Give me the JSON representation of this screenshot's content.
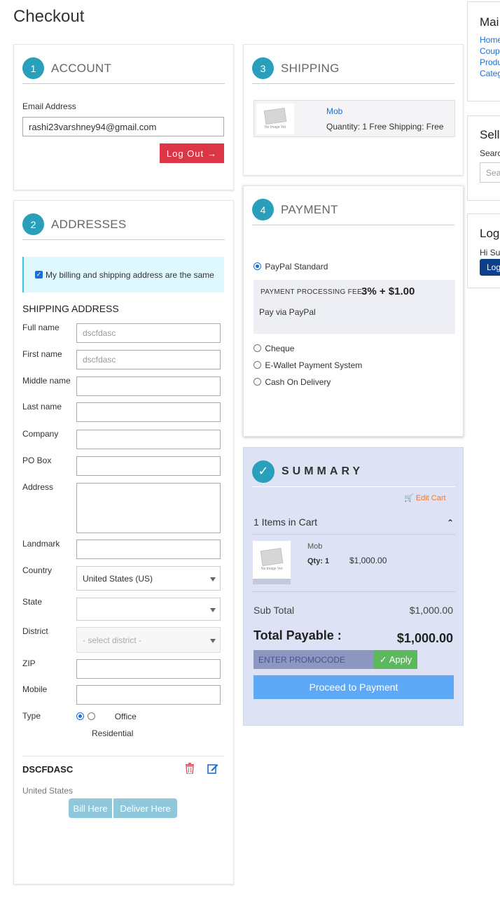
{
  "page": {
    "title": "Checkout"
  },
  "account": {
    "step": "1",
    "title": "ACCOUNT",
    "email_label": "Email Address",
    "email_value": "rashi23varshney94@gmail.com",
    "logout_label": "Log Out"
  },
  "addresses": {
    "step": "2",
    "title": "ADDRESSES",
    "same_address_label": "My billing and shipping address are the same",
    "shipping_heading": "SHIPPING ADDRESS",
    "fields": {
      "full_name": {
        "label": "Full name",
        "value": "dscfdasc"
      },
      "first_name": {
        "label": "First name",
        "value": "dscfdasc"
      },
      "middle_name": {
        "label": "Middle name",
        "value": ""
      },
      "last_name": {
        "label": "Last name",
        "value": ""
      },
      "company": {
        "label": "Company",
        "value": ""
      },
      "po_box": {
        "label": "PO Box",
        "value": ""
      },
      "address": {
        "label": "Address",
        "value": ""
      },
      "landmark": {
        "label": "Landmark",
        "value": ""
      },
      "country": {
        "label": "Country",
        "value": "United States (US)"
      },
      "state": {
        "label": "State",
        "value": ""
      },
      "district": {
        "label": "District",
        "value": "- select district -"
      },
      "zip": {
        "label": "ZIP",
        "value": ""
      },
      "mobile": {
        "label": "Mobile",
        "value": ""
      },
      "type": {
        "label": "Type",
        "option_office": "Office",
        "option_residential": "Residential"
      }
    },
    "saved": {
      "name": "DSCFDASC",
      "country": "United States",
      "bill_label": "Bill Here",
      "deliver_label": "Deliver Here"
    }
  },
  "shipping": {
    "step": "3",
    "title": "SHIPPING",
    "item_name": "Mob",
    "item_details": "Quantity: 1 Free Shipping: Free",
    "thumb_text": "No Image Yet"
  },
  "payment": {
    "step": "4",
    "title": "PAYMENT",
    "options": [
      "PayPal Standard",
      "Cheque",
      "E-Wallet Payment System",
      "Cash On Delivery"
    ],
    "fee_label": "PAYMENT PROCESSING FEE:",
    "fee_value": "3% + $1.00",
    "fee_note": "Pay via PayPal"
  },
  "summary": {
    "title": "SUMMARY",
    "edit_cart": "Edit Cart",
    "items_in_cart": "1 Items in Cart",
    "item_name": "Mob",
    "item_qty": "Qty: 1",
    "item_price": "$1,000.00",
    "subtotal_label": "Sub Total",
    "subtotal_value": "$1,000.00",
    "total_label": "Total Payable :",
    "total_value": "$1,000.00",
    "promo_placeholder": "ENTER PROMOCODE",
    "apply_label": "Apply",
    "proceed_label": "Proceed to Payment"
  },
  "sidebar": {
    "main_title": "Mai",
    "links": [
      "Home",
      "Coup",
      "Produ",
      "Categ"
    ],
    "seller_title": "Sella",
    "search_label": "Searc",
    "search_placeholder": "Sea",
    "login_title": "Logi",
    "greeting": "Hi Su",
    "login_button": "Log"
  },
  "colors": {
    "step_circle": "#2a9fbc",
    "logout_button": "#dc3545",
    "summary_bg": "#dde2f4",
    "proceed_button": "#5ea9f7",
    "apply_button": "#5cb85c"
  }
}
